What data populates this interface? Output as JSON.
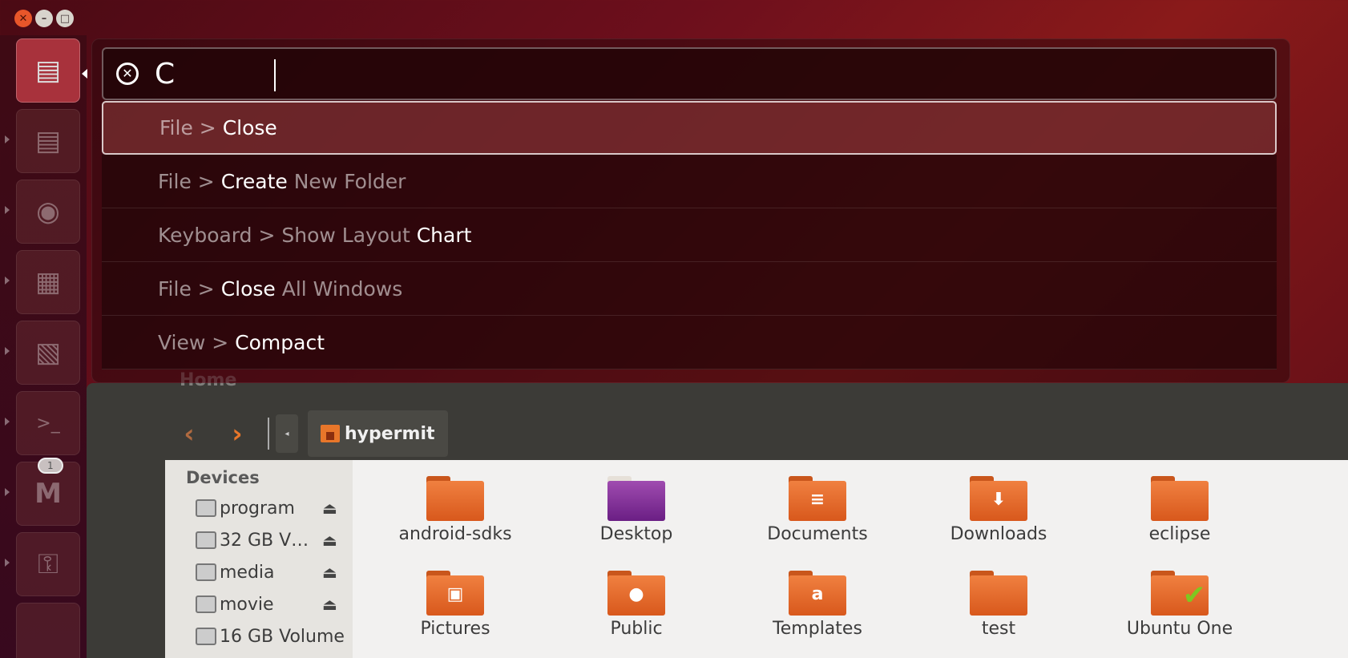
{
  "hud": {
    "query": "C",
    "results": [
      {
        "parts": [
          {
            "t": "File > ",
            "hl": false
          },
          {
            "t": "Close",
            "hl": true
          }
        ]
      },
      {
        "parts": [
          {
            "t": "File > ",
            "hl": false
          },
          {
            "t": "Create",
            "hl": true
          },
          {
            "t": " New Folder",
            "hl": false
          }
        ]
      },
      {
        "parts": [
          {
            "t": "Keyboard > Show Layout ",
            "hl": false
          },
          {
            "t": "Chart",
            "hl": true
          }
        ]
      },
      {
        "parts": [
          {
            "t": "File > ",
            "hl": false
          },
          {
            "t": "Close",
            "hl": true
          },
          {
            "t": " All Windows",
            "hl": false
          }
        ]
      },
      {
        "parts": [
          {
            "t": "View > ",
            "hl": false
          },
          {
            "t": "Compact",
            "hl": true
          }
        ]
      }
    ]
  },
  "launcher": {
    "gmail_badge": "1",
    "icons": [
      "file-cabinet-icon",
      "file-cabinet-icon",
      "firefox-icon",
      "impress-icon",
      "image-viewer-icon",
      "terminal-icon",
      "gmail-icon",
      "passwords-icon"
    ]
  },
  "file_manager": {
    "title": "Home",
    "path_label": "hypermit",
    "sidebar_heading": "Devices",
    "devices": [
      {
        "label": "program",
        "eject": true
      },
      {
        "label": "32 GB V…",
        "eject": true
      },
      {
        "label": "media",
        "eject": true
      },
      {
        "label": "movie",
        "eject": true
      },
      {
        "label": "16 GB Volume",
        "eject": false
      }
    ],
    "items": [
      {
        "label": "android-sdks",
        "emblem": ""
      },
      {
        "label": "Desktop",
        "emblem": "desktop"
      },
      {
        "label": "Documents",
        "emblem": "doc"
      },
      {
        "label": "Downloads",
        "emblem": "down"
      },
      {
        "label": "eclipse",
        "emblem": ""
      },
      {
        "label": "Pictures",
        "emblem": "pic"
      },
      {
        "label": "Public",
        "emblem": "person"
      },
      {
        "label": "Templates",
        "emblem": "tmpl"
      },
      {
        "label": "test",
        "emblem": ""
      },
      {
        "label": "Ubuntu One",
        "emblem": "check"
      }
    ]
  },
  "colors": {
    "accent": "#e8762a",
    "close_button": "#e8562a"
  }
}
